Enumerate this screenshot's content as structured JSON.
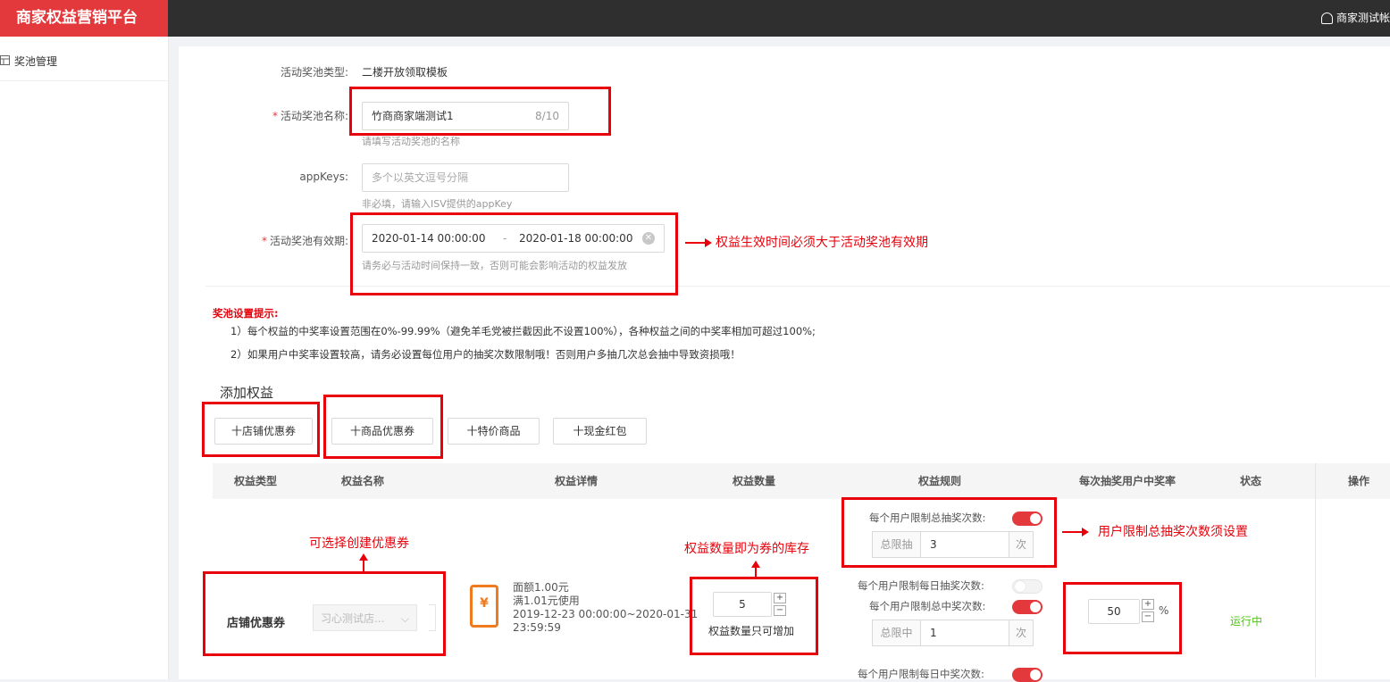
{
  "header": {
    "brand": "商家权益营销平台",
    "user": "商家测试帐"
  },
  "sidebar": {
    "items": [
      {
        "icon": "table-icon",
        "label": "奖池管理"
      }
    ]
  },
  "form": {
    "pool_type": {
      "label": "活动奖池类型:",
      "value": "二楼开放领取模板"
    },
    "pool_name": {
      "label": "活动奖池名称:",
      "value": "竹商商家端测试1",
      "count": "8/10",
      "hint": "请填写活动奖池的名称"
    },
    "appkeys": {
      "label": "appKeys:",
      "placeholder": "多个以英文逗号分隔",
      "hint": "非必填，请输入ISV提供的appKey"
    },
    "validity": {
      "label": "活动奖池有效期:",
      "start": "2020-01-14 00:00:00",
      "separator": "-",
      "end": "2020-01-18 00:00:00",
      "hint": "请务必与活动时间保持一致，否则可能会影响活动的权益发放"
    }
  },
  "tips": {
    "title": "奖池设置提示:",
    "lines": [
      "1）每个权益的中奖率设置范围在0%-99.99%（避免羊毛党被拦截因此不设置100%），各种权益之间的中奖率相加可超过100%;",
      "2）如果用户中奖率设置较高，请务必设置每位用户的抽奖次数限制哦！否则用户多抽几次总会抽中导致资损哦！"
    ]
  },
  "add_section": {
    "title": "添加权益",
    "buttons": [
      "十店铺优惠券",
      "十商品优惠券",
      "十特价商品",
      "十现金红包"
    ]
  },
  "table": {
    "headers": [
      "权益类型",
      "权益名称",
      "权益详情",
      "权益数量",
      "权益规则",
      "每次抽奖用户中奖率",
      "状态",
      "操作"
    ],
    "row": {
      "type": "店铺优惠券",
      "name_select": "习心测试店...",
      "coupon": {
        "face": "面额1.00元",
        "condition": "满1.01元使用",
        "period": "2019-12-23 00:00:00~2020-01-31",
        "period_end": "23:59:59",
        "symbol": "¥"
      },
      "quantity": "5",
      "quantity_hint": "权益数量只可增加",
      "rules": {
        "total_draw_label": "每个用户限制总抽奖次数:",
        "total_draw_prefix": "总限抽",
        "total_draw_value": "3",
        "total_draw_suffix": "次",
        "daily_draw_label": "每个用户限制每日抽奖次数:",
        "total_win_label": "每个用户限制总中奖次数:",
        "total_win_prefix": "总限中",
        "total_win_value": "1",
        "total_win_suffix": "次",
        "daily_win_label": "每个用户限制每日中奖次数:"
      },
      "rate": "50",
      "rate_unit": "%",
      "status": "运行中"
    }
  },
  "annotations": {
    "validity_note": "权益生效时间必须大于活动奖池有效期",
    "coupon_note": "可选择创建优惠券",
    "quantity_note": "权益数量即为券的库存",
    "limit_note": "用户限制总抽奖次数须设置"
  },
  "colors": {
    "brand": "#e4393c",
    "annotation": "#e8000b",
    "status_running": "#52c41a"
  }
}
